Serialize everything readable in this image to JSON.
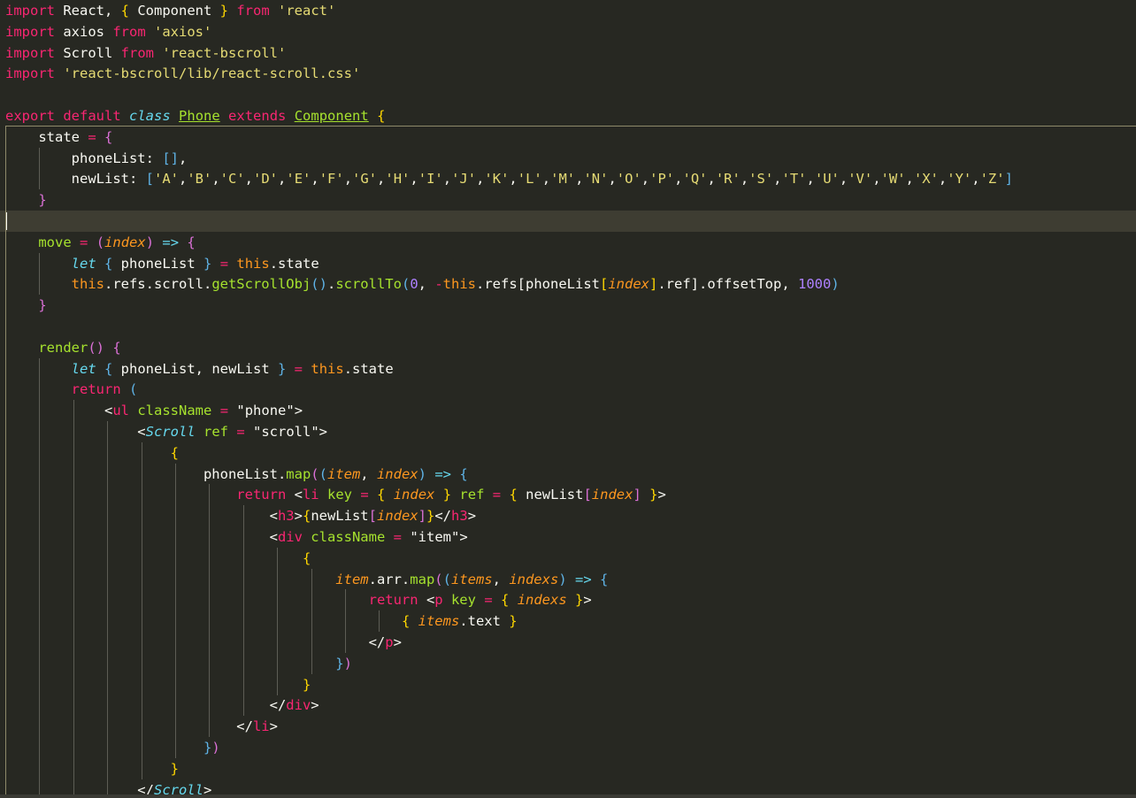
{
  "editor": {
    "lines": [
      [
        [
          "kw",
          "import"
        ],
        [
          "pl",
          " React, "
        ],
        [
          "br1",
          "{"
        ],
        [
          "pl",
          " Component "
        ],
        [
          "br1",
          "}"
        ],
        [
          "pl",
          " "
        ],
        [
          "kw",
          "from"
        ],
        [
          "pl",
          " "
        ],
        [
          "st",
          "'react'"
        ]
      ],
      [
        [
          "kw",
          "import"
        ],
        [
          "pl",
          " axios "
        ],
        [
          "kw",
          "from"
        ],
        [
          "pl",
          " "
        ],
        [
          "st",
          "'axios'"
        ]
      ],
      [
        [
          "kw",
          "import"
        ],
        [
          "pl",
          " Scroll "
        ],
        [
          "kw",
          "from"
        ],
        [
          "pl",
          " "
        ],
        [
          "st",
          "'react-bscroll'"
        ]
      ],
      [
        [
          "kw",
          "import"
        ],
        [
          "pl",
          " "
        ],
        [
          "st",
          "'react-bscroll/lib/react-scroll.css'"
        ]
      ],
      [],
      [
        [
          "kw",
          "export"
        ],
        [
          "pl",
          " "
        ],
        [
          "kw",
          "default"
        ],
        [
          "pl",
          " "
        ],
        [
          "cls",
          "class"
        ],
        [
          "pl",
          " "
        ],
        [
          "typu",
          "Phone"
        ],
        [
          "pl",
          " "
        ],
        [
          "kw",
          "extends"
        ],
        [
          "pl",
          " "
        ],
        [
          "typu",
          "Component"
        ],
        [
          "pl",
          " "
        ],
        [
          "br1",
          "{"
        ]
      ],
      [
        [
          "pl",
          "    state "
        ],
        [
          "op",
          "="
        ],
        [
          "pl",
          " "
        ],
        [
          "br2",
          "{"
        ]
      ],
      [
        [
          "pl",
          "        phoneList: "
        ],
        [
          "br3",
          "[]"
        ],
        [
          "pl",
          ","
        ]
      ],
      [
        [
          "pl",
          "        newList: "
        ],
        [
          "br3",
          "["
        ],
        [
          "st",
          "'A'"
        ],
        [
          "pl",
          ","
        ],
        [
          "st",
          "'B'"
        ],
        [
          "pl",
          ","
        ],
        [
          "st",
          "'C'"
        ],
        [
          "pl",
          ","
        ],
        [
          "st",
          "'D'"
        ],
        [
          "pl",
          ","
        ],
        [
          "st",
          "'E'"
        ],
        [
          "pl",
          ","
        ],
        [
          "st",
          "'F'"
        ],
        [
          "pl",
          ","
        ],
        [
          "st",
          "'G'"
        ],
        [
          "pl",
          ","
        ],
        [
          "st",
          "'H'"
        ],
        [
          "pl",
          ","
        ],
        [
          "st",
          "'I'"
        ],
        [
          "pl",
          ","
        ],
        [
          "st",
          "'J'"
        ],
        [
          "pl",
          ","
        ],
        [
          "st",
          "'K'"
        ],
        [
          "pl",
          ","
        ],
        [
          "st",
          "'L'"
        ],
        [
          "pl",
          ","
        ],
        [
          "st",
          "'M'"
        ],
        [
          "pl",
          ","
        ],
        [
          "st",
          "'N'"
        ],
        [
          "pl",
          ","
        ],
        [
          "st",
          "'O'"
        ],
        [
          "pl",
          ","
        ],
        [
          "st",
          "'P'"
        ],
        [
          "pl",
          ","
        ],
        [
          "st",
          "'Q'"
        ],
        [
          "pl",
          ","
        ],
        [
          "st",
          "'R'"
        ],
        [
          "pl",
          ","
        ],
        [
          "st",
          "'S'"
        ],
        [
          "pl",
          ","
        ],
        [
          "st",
          "'T'"
        ],
        [
          "pl",
          ","
        ],
        [
          "st",
          "'U'"
        ],
        [
          "pl",
          ","
        ],
        [
          "st",
          "'V'"
        ],
        [
          "pl",
          ","
        ],
        [
          "st",
          "'W'"
        ],
        [
          "pl",
          ","
        ],
        [
          "st",
          "'X'"
        ],
        [
          "pl",
          ","
        ],
        [
          "st",
          "'Y'"
        ],
        [
          "pl",
          ","
        ],
        [
          "st",
          "'Z'"
        ],
        [
          "br3",
          "]"
        ]
      ],
      [
        [
          "pl",
          "    "
        ],
        [
          "br2",
          "}"
        ]
      ],
      [],
      [
        [
          "pl",
          "    "
        ],
        [
          "fn",
          "move"
        ],
        [
          "pl",
          " "
        ],
        [
          "op",
          "="
        ],
        [
          "pl",
          " "
        ],
        [
          "br2",
          "("
        ],
        [
          "prm",
          "index"
        ],
        [
          "br2",
          ")"
        ],
        [
          "pl",
          " "
        ],
        [
          "ar",
          "=>"
        ],
        [
          "pl",
          " "
        ],
        [
          "br2",
          "{"
        ]
      ],
      [
        [
          "pl",
          "        "
        ],
        [
          "cls",
          "let"
        ],
        [
          "pl",
          " "
        ],
        [
          "br3",
          "{"
        ],
        [
          "pl",
          " phoneList "
        ],
        [
          "br3",
          "}"
        ],
        [
          "pl",
          " "
        ],
        [
          "op",
          "="
        ],
        [
          "pl",
          " "
        ],
        [
          "thi",
          "this"
        ],
        [
          "pl",
          ".state"
        ]
      ],
      [
        [
          "pl",
          "        "
        ],
        [
          "thi",
          "this"
        ],
        [
          "pl",
          ".refs.scroll."
        ],
        [
          "fn",
          "getScrollObj"
        ],
        [
          "br3",
          "()"
        ],
        [
          "pl",
          "."
        ],
        [
          "fn",
          "scrollTo"
        ],
        [
          "br3",
          "("
        ],
        [
          "num",
          "0"
        ],
        [
          "pl",
          ", "
        ],
        [
          "op",
          "-"
        ],
        [
          "thi",
          "this"
        ],
        [
          "pl",
          ".refs[phoneList"
        ],
        [
          "br1",
          "["
        ],
        [
          "prm",
          "index"
        ],
        [
          "br1",
          "]"
        ],
        [
          "pl",
          ".ref].offsetTop, "
        ],
        [
          "num",
          "1000"
        ],
        [
          "br3",
          ")"
        ]
      ],
      [
        [
          "pl",
          "    "
        ],
        [
          "br2",
          "}"
        ]
      ],
      [],
      [
        [
          "pl",
          "    "
        ],
        [
          "fn",
          "render"
        ],
        [
          "br2",
          "()"
        ],
        [
          "pl",
          " "
        ],
        [
          "br2",
          "{"
        ]
      ],
      [
        [
          "pl",
          "        "
        ],
        [
          "cls",
          "let"
        ],
        [
          "pl",
          " "
        ],
        [
          "br3",
          "{"
        ],
        [
          "pl",
          " phoneList, newList "
        ],
        [
          "br3",
          "}"
        ],
        [
          "pl",
          " "
        ],
        [
          "op",
          "="
        ],
        [
          "pl",
          " "
        ],
        [
          "thi",
          "this"
        ],
        [
          "pl",
          ".state"
        ]
      ],
      [
        [
          "pl",
          "        "
        ],
        [
          "kw",
          "return"
        ],
        [
          "pl",
          " "
        ],
        [
          "br3",
          "("
        ]
      ],
      [
        [
          "pl",
          "            <"
        ],
        [
          "tag",
          "ul"
        ],
        [
          "pl",
          " "
        ],
        [
          "at",
          "className"
        ],
        [
          "pl",
          " "
        ],
        [
          "op",
          "="
        ],
        [
          "pl",
          " "
        ],
        [
          "pl",
          "\"phone\""
        ],
        [
          "pl",
          ">"
        ]
      ],
      [
        [
          "pl",
          "                <"
        ],
        [
          "jsx",
          "Scroll"
        ],
        [
          "pl",
          " "
        ],
        [
          "at",
          "ref"
        ],
        [
          "pl",
          " "
        ],
        [
          "op",
          "="
        ],
        [
          "pl",
          " "
        ],
        [
          "pl",
          "\"scroll\""
        ],
        [
          "pl",
          ">"
        ]
      ],
      [
        [
          "pl",
          "                    "
        ],
        [
          "br1",
          "{"
        ]
      ],
      [
        [
          "pl",
          "                        phoneList."
        ],
        [
          "fn",
          "map"
        ],
        [
          "br2",
          "("
        ],
        [
          "br3",
          "("
        ],
        [
          "prm",
          "item"
        ],
        [
          "pl",
          ", "
        ],
        [
          "prm",
          "index"
        ],
        [
          "br3",
          ")"
        ],
        [
          "pl",
          " "
        ],
        [
          "ar",
          "=>"
        ],
        [
          "pl",
          " "
        ],
        [
          "br3",
          "{"
        ]
      ],
      [
        [
          "pl",
          "                            "
        ],
        [
          "kw",
          "return"
        ],
        [
          "pl",
          " <"
        ],
        [
          "tag",
          "li"
        ],
        [
          "pl",
          " "
        ],
        [
          "at",
          "key"
        ],
        [
          "pl",
          " "
        ],
        [
          "op",
          "="
        ],
        [
          "pl",
          " "
        ],
        [
          "br1",
          "{"
        ],
        [
          "pl",
          " "
        ],
        [
          "prm",
          "index"
        ],
        [
          "pl",
          " "
        ],
        [
          "br1",
          "}"
        ],
        [
          "pl",
          " "
        ],
        [
          "at",
          "ref"
        ],
        [
          "pl",
          " "
        ],
        [
          "op",
          "="
        ],
        [
          "pl",
          " "
        ],
        [
          "br1",
          "{"
        ],
        [
          "pl",
          " newList"
        ],
        [
          "br2",
          "["
        ],
        [
          "prm",
          "index"
        ],
        [
          "br2",
          "]"
        ],
        [
          "pl",
          " "
        ],
        [
          "br1",
          "}"
        ],
        [
          "pl",
          ">"
        ]
      ],
      [
        [
          "pl",
          "                                <"
        ],
        [
          "tag",
          "h3"
        ],
        [
          "pl",
          ">"
        ],
        [
          "br1",
          "{"
        ],
        [
          "pl",
          "newList"
        ],
        [
          "br2",
          "["
        ],
        [
          "prm",
          "index"
        ],
        [
          "br2",
          "]"
        ],
        [
          "br1",
          "}"
        ],
        [
          "pl",
          "</"
        ],
        [
          "tag",
          "h3"
        ],
        [
          "pl",
          ">"
        ]
      ],
      [
        [
          "pl",
          "                                <"
        ],
        [
          "tag",
          "div"
        ],
        [
          "pl",
          " "
        ],
        [
          "at",
          "className"
        ],
        [
          "pl",
          " "
        ],
        [
          "op",
          "="
        ],
        [
          "pl",
          " "
        ],
        [
          "pl",
          "\"item\""
        ],
        [
          "pl",
          ">"
        ]
      ],
      [
        [
          "pl",
          "                                    "
        ],
        [
          "br1",
          "{"
        ]
      ],
      [
        [
          "pl",
          "                                        "
        ],
        [
          "prm",
          "item"
        ],
        [
          "pl",
          ".arr."
        ],
        [
          "fn",
          "map"
        ],
        [
          "br2",
          "("
        ],
        [
          "br3",
          "("
        ],
        [
          "prm",
          "items"
        ],
        [
          "pl",
          ", "
        ],
        [
          "prm",
          "indexs"
        ],
        [
          "br3",
          ")"
        ],
        [
          "pl",
          " "
        ],
        [
          "ar",
          "=>"
        ],
        [
          "pl",
          " "
        ],
        [
          "br3",
          "{"
        ]
      ],
      [
        [
          "pl",
          "                                            "
        ],
        [
          "kw",
          "return"
        ],
        [
          "pl",
          " <"
        ],
        [
          "tag",
          "p"
        ],
        [
          "pl",
          " "
        ],
        [
          "at",
          "key"
        ],
        [
          "pl",
          " "
        ],
        [
          "op",
          "="
        ],
        [
          "pl",
          " "
        ],
        [
          "br1",
          "{"
        ],
        [
          "pl",
          " "
        ],
        [
          "prm",
          "indexs"
        ],
        [
          "pl",
          " "
        ],
        [
          "br1",
          "}"
        ],
        [
          "pl",
          ">"
        ]
      ],
      [
        [
          "pl",
          "                                                "
        ],
        [
          "br1",
          "{"
        ],
        [
          "pl",
          " "
        ],
        [
          "prm",
          "items"
        ],
        [
          "pl",
          ".text "
        ],
        [
          "br1",
          "}"
        ]
      ],
      [
        [
          "pl",
          "                                            </"
        ],
        [
          "tag",
          "p"
        ],
        [
          "pl",
          ">"
        ]
      ],
      [
        [
          "pl",
          "                                        "
        ],
        [
          "br3",
          "}"
        ],
        [
          "br2",
          ")"
        ]
      ],
      [
        [
          "pl",
          "                                    "
        ],
        [
          "br1",
          "}"
        ]
      ],
      [
        [
          "pl",
          "                                </"
        ],
        [
          "tag",
          "div"
        ],
        [
          "pl",
          ">"
        ]
      ],
      [
        [
          "pl",
          "                            </"
        ],
        [
          "tag",
          "li"
        ],
        [
          "pl",
          ">"
        ]
      ],
      [
        [
          "pl",
          "                        "
        ],
        [
          "br3",
          "}"
        ],
        [
          "br2",
          ")"
        ]
      ],
      [
        [
          "pl",
          "                    "
        ],
        [
          "br1",
          "}"
        ]
      ],
      [
        [
          "pl",
          "                </"
        ],
        [
          "jsx",
          "Scroll"
        ],
        [
          "pl",
          ">"
        ]
      ]
    ]
  },
  "colors": {
    "background": "#272822",
    "current_line": "#3e3d32",
    "keyword": "#f92672",
    "string": "#e6db74",
    "function": "#a6e22e",
    "parameter": "#fd971f",
    "number": "#ae81ff",
    "storage": "#66d9ef"
  }
}
